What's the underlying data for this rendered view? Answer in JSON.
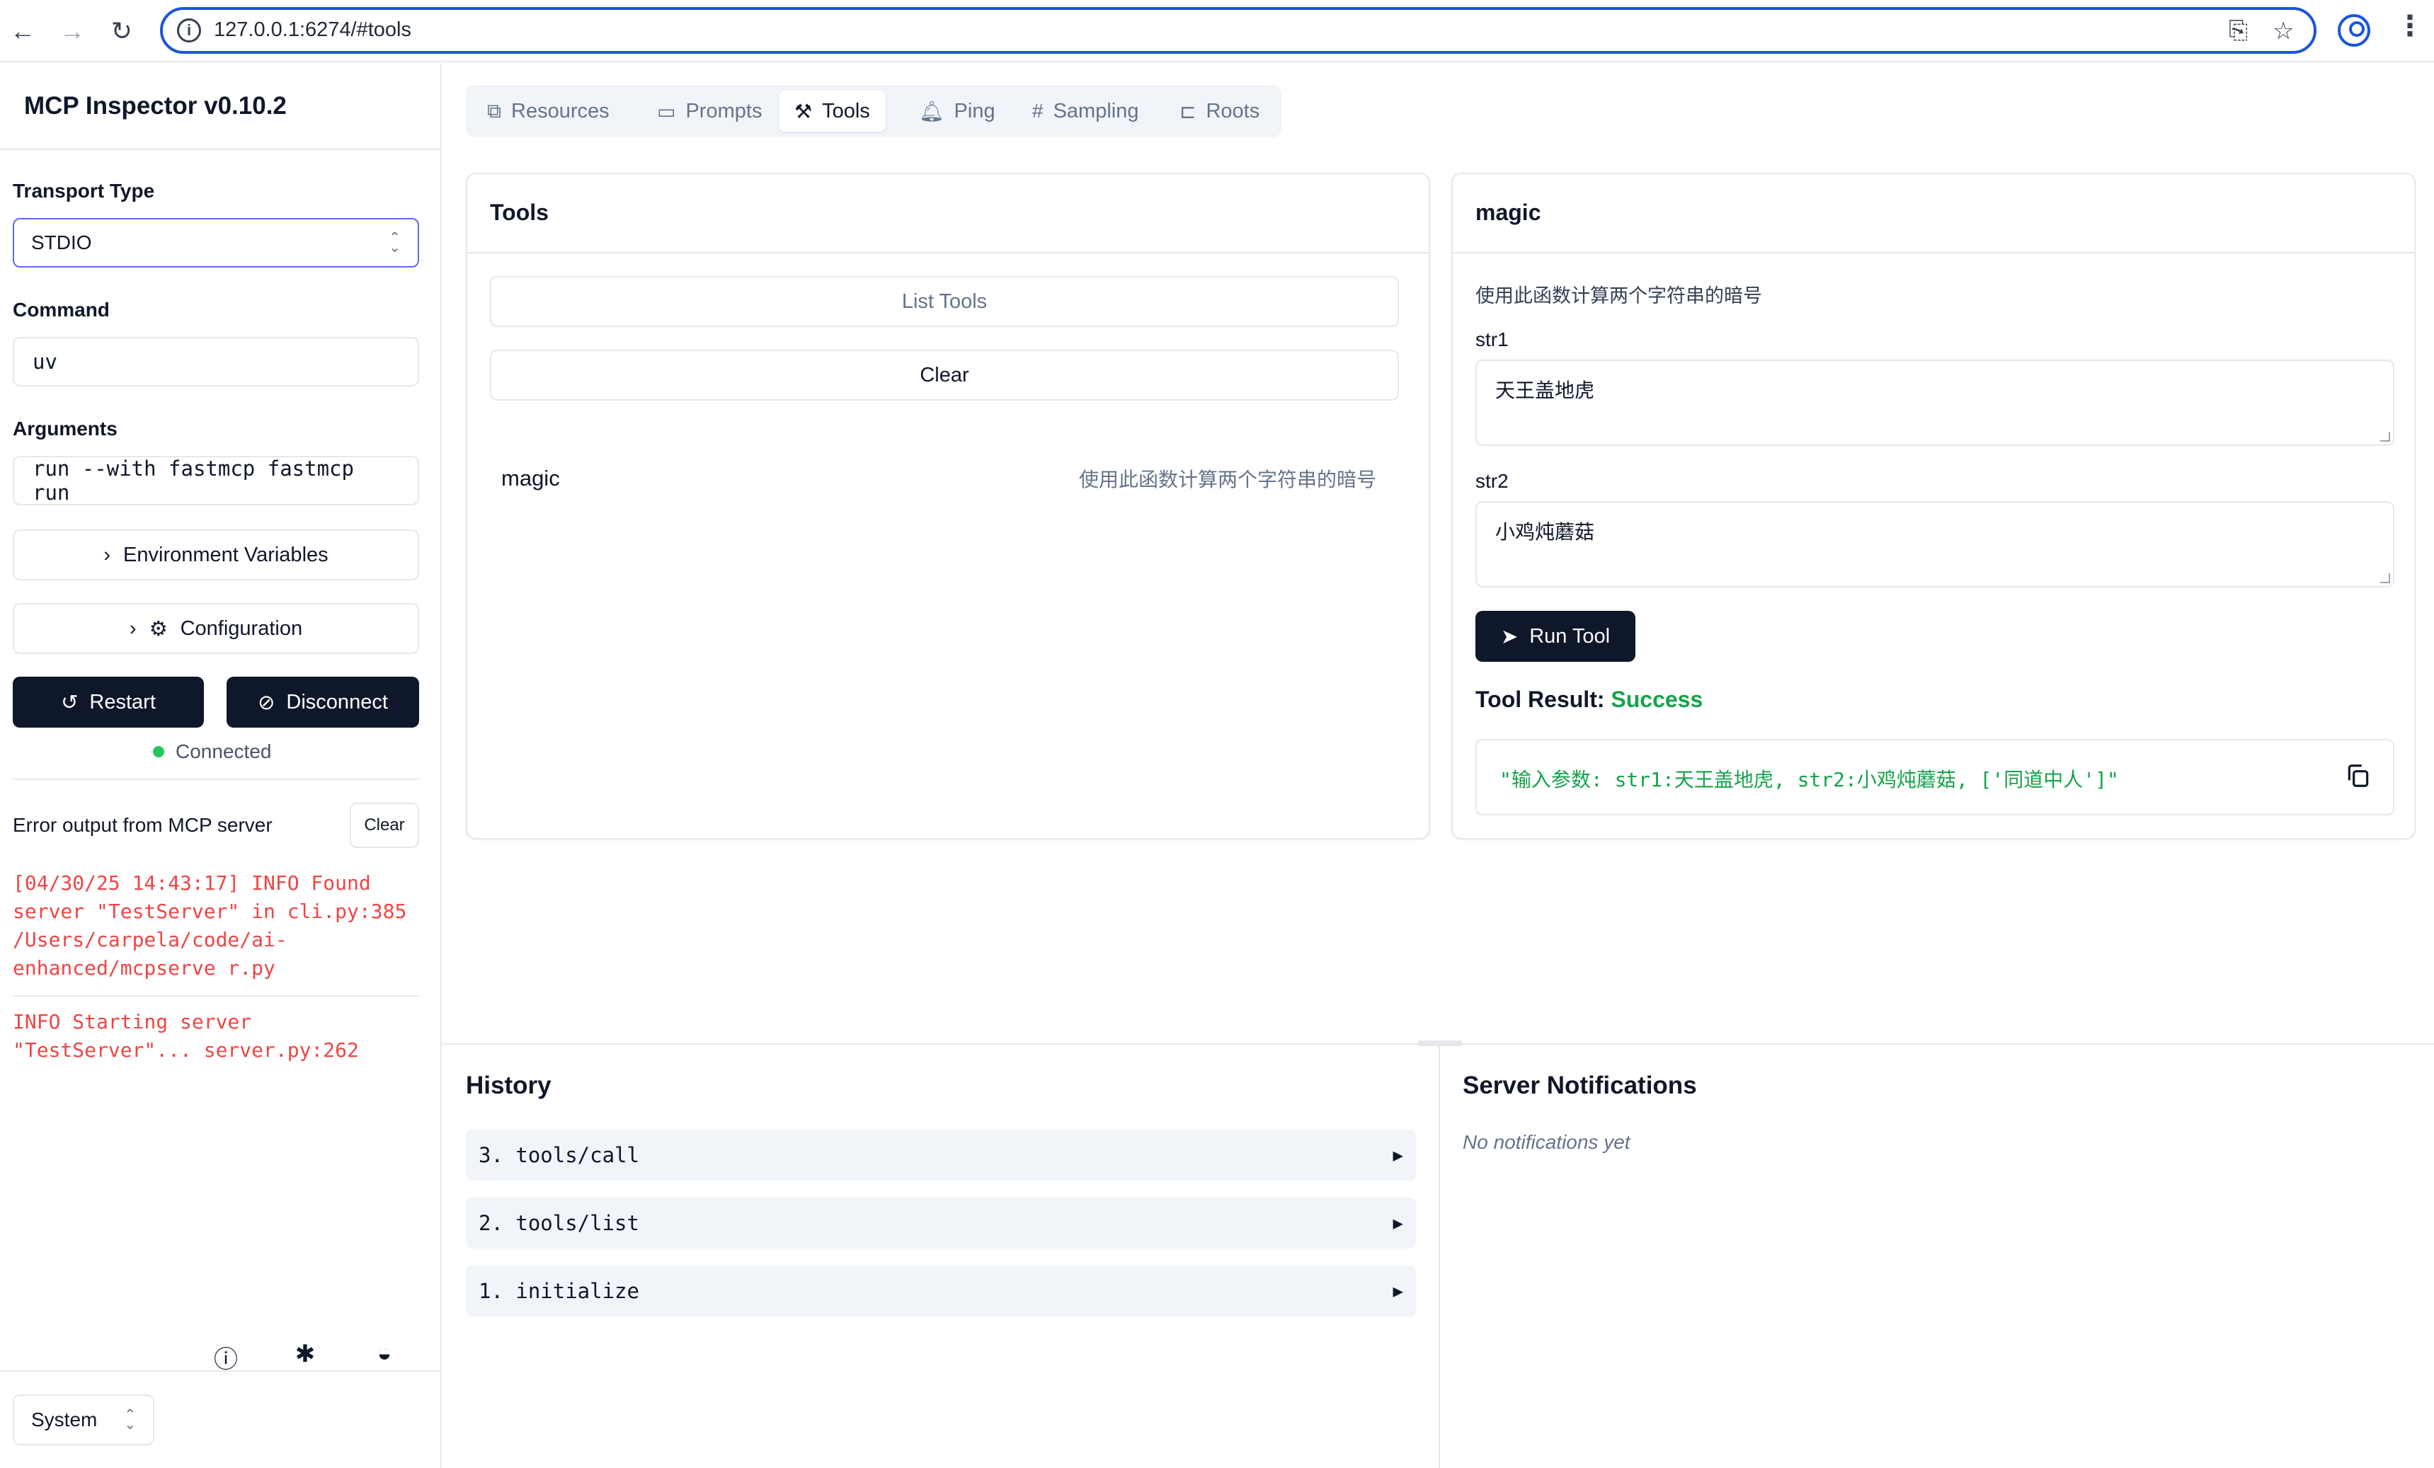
{
  "browser": {
    "url": "127.0.0.1:6274/#tools"
  },
  "sidebar": {
    "title": "MCP Inspector v0.10.2",
    "transport_label": "Transport Type",
    "transport_value": "STDIO",
    "command_label": "Command",
    "command_value": "uv",
    "arguments_label": "Arguments",
    "arguments_value": "run --with fastmcp fastmcp run",
    "env_label": "Environment Variables",
    "config_label": "Configuration",
    "restart_label": "Restart",
    "disconnect_label": "Disconnect",
    "status": "Connected",
    "error_title": "Error output from MCP server",
    "clear_label": "Clear",
    "logs": [
      "[04/30/25 14:43:17] INFO Found\nserver \"TestServer\" in cli.py:385\n/Users/carpela/code/ai-\nenhanced/mcpserve r.py",
      "INFO Starting server\n\"TestServer\"... server.py:262"
    ],
    "theme_value": "System"
  },
  "tabs": [
    "Resources",
    "Prompts",
    "Tools",
    "Ping",
    "Sampling",
    "Roots"
  ],
  "tools_panel": {
    "title": "Tools",
    "list_label": "List Tools",
    "clear_label": "Clear",
    "tool": {
      "name": "magic",
      "description": "使用此函数计算两个字符串的暗号"
    }
  },
  "detail_panel": {
    "title": "magic",
    "description": "使用此函数计算两个字符串的暗号",
    "param1_label": "str1",
    "param1_value": "天王盖地虎",
    "param2_label": "str2",
    "param2_value": "小鸡炖蘑菇",
    "run_label": "Run Tool",
    "result_label": "Tool Result:",
    "result_status": "Success",
    "result_text": "\"输入参数: str1:天王盖地虎, str2:小鸡炖蘑菇, ['同道中人']\""
  },
  "history": {
    "title": "History",
    "items": [
      "3. tools/call",
      "2. tools/list",
      "1. initialize"
    ]
  },
  "notifications": {
    "title": "Server Notifications",
    "empty": "No notifications yet"
  }
}
